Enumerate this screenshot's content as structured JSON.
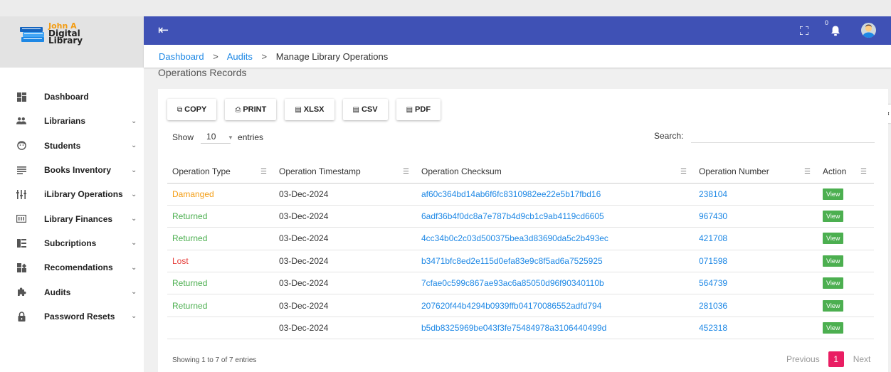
{
  "brand": {
    "line1": "John A",
    "line2": "Digital",
    "line3": "Library"
  },
  "sidebar": {
    "items": [
      {
        "label": "Dashboard",
        "icon": "dashboard-icon",
        "chevron": false
      },
      {
        "label": "Librarians",
        "icon": "people-icon",
        "chevron": true
      },
      {
        "label": "Students",
        "icon": "face-icon",
        "chevron": true
      },
      {
        "label": "Books Inventory",
        "icon": "list-icon",
        "chevron": true
      },
      {
        "label": "iLibrary Operations",
        "icon": "operations-icon",
        "chevron": true
      },
      {
        "label": "Library Finances",
        "icon": "finance-icon",
        "chevron": true
      },
      {
        "label": "Subcriptions",
        "icon": "subscriptions-icon",
        "chevron": true
      },
      {
        "label": "Recomendations",
        "icon": "recommendations-icon",
        "chevron": true
      },
      {
        "label": "Audits",
        "icon": "puzzle-icon",
        "chevron": true
      },
      {
        "label": "Password Resets",
        "icon": "lock-icon",
        "chevron": true
      }
    ]
  },
  "header": {
    "notification_count": "0"
  },
  "breadcrumb": {
    "items": [
      "Dashboard",
      "Audits"
    ],
    "current": "Manage Library Operations"
  },
  "page_title": "Operations Records",
  "toolbar": {
    "copy": "COPY",
    "print": "PRINT",
    "xlsx": "XLSX",
    "csv": "CSV",
    "pdf": "PDF"
  },
  "length": {
    "show": "Show",
    "entries": "entries",
    "selected": "10"
  },
  "search": {
    "label": "Search:"
  },
  "table": {
    "headers": [
      "Operation Type",
      "Operation Timestamp",
      "Operation Checksum",
      "Operation Number",
      "Action"
    ],
    "rows": [
      {
        "type": "Damanged",
        "status": "damaged",
        "timestamp": "03-Dec-2024",
        "checksum": "af60c364bd14ab6f6fc8310982ee22e5b17fbd16",
        "number": "238104",
        "action": "View"
      },
      {
        "type": "Returned",
        "status": "returned",
        "timestamp": "03-Dec-2024",
        "checksum": "6adf36b4f0dc8a7e787b4d9cb1c9ab4119cd6605",
        "number": "967430",
        "action": "View"
      },
      {
        "type": "Returned",
        "status": "returned",
        "timestamp": "03-Dec-2024",
        "checksum": "4cc34b0c2c03d500375bea3d83690da5c2b493ec",
        "number": "421708",
        "action": "View"
      },
      {
        "type": "Lost",
        "status": "lost",
        "timestamp": "03-Dec-2024",
        "checksum": "b3471bfc8ed2e115d0efa83e9c8f5ad6a7525925",
        "number": "071598",
        "action": "View"
      },
      {
        "type": "Returned",
        "status": "returned",
        "timestamp": "03-Dec-2024",
        "checksum": "7cfae0c599c867ae93ac6a85050d96f90340110b",
        "number": "564739",
        "action": "View"
      },
      {
        "type": "Returned",
        "status": "returned",
        "timestamp": "03-Dec-2024",
        "checksum": "207620f44b4294b0939ffb04170086552adfd794",
        "number": "281036",
        "action": "View"
      },
      {
        "type": "",
        "status": "",
        "timestamp": "03-Dec-2024",
        "checksum": "b5db8325969be043f3fe75484978a3106440499d",
        "number": "452318",
        "action": "View"
      }
    ]
  },
  "footer": {
    "info": "Showing 1 to 7 of 7 entries",
    "previous": "Previous",
    "current_page": "1",
    "next": "Next"
  },
  "colors": {
    "header": "#3f51b5",
    "link": "#1e88e5",
    "damaged": "#f39c12",
    "returned": "#4caf50",
    "lost": "#e53935",
    "pager_active": "#e91e63"
  }
}
